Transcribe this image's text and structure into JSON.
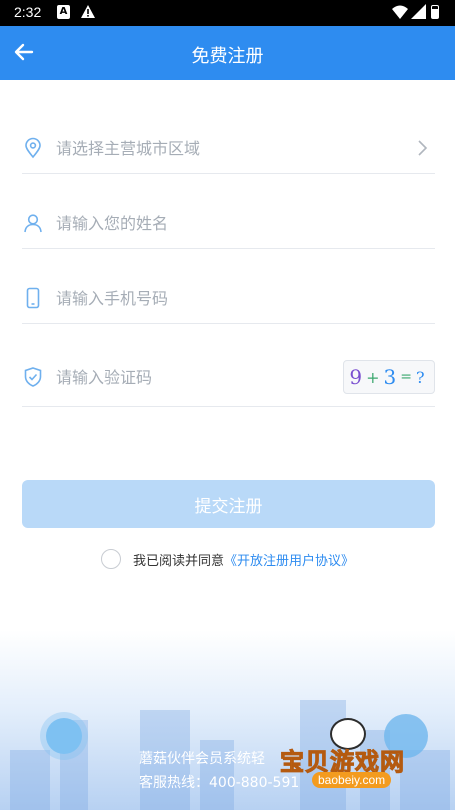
{
  "status_bar": {
    "time": "2:32",
    "n_badge": "A"
  },
  "app_bar": {
    "title": "免费注册"
  },
  "form": {
    "region_placeholder": "请选择主营城市区域",
    "name_placeholder": "请输入您的姓名",
    "phone_placeholder": "请输入手机号码",
    "code_placeholder": "请输入验证码",
    "captcha": [
      "9",
      "+",
      "3",
      "=",
      "?"
    ]
  },
  "submit": {
    "label": "提交注册"
  },
  "agreement": {
    "prefix": "我已阅读并同意",
    "link": "《开放注册用户协议》"
  },
  "footer": {
    "line1": "蘑菇伙伴会员系统轻",
    "line2": "客服热线：400-880-591"
  },
  "watermark": {
    "title": "宝贝游戏网",
    "url": "baobeiy.com"
  },
  "colors": {
    "primary": "#2e8cf0",
    "button_disabled": "#b9d9f8",
    "divider": "#e6e9ee"
  }
}
